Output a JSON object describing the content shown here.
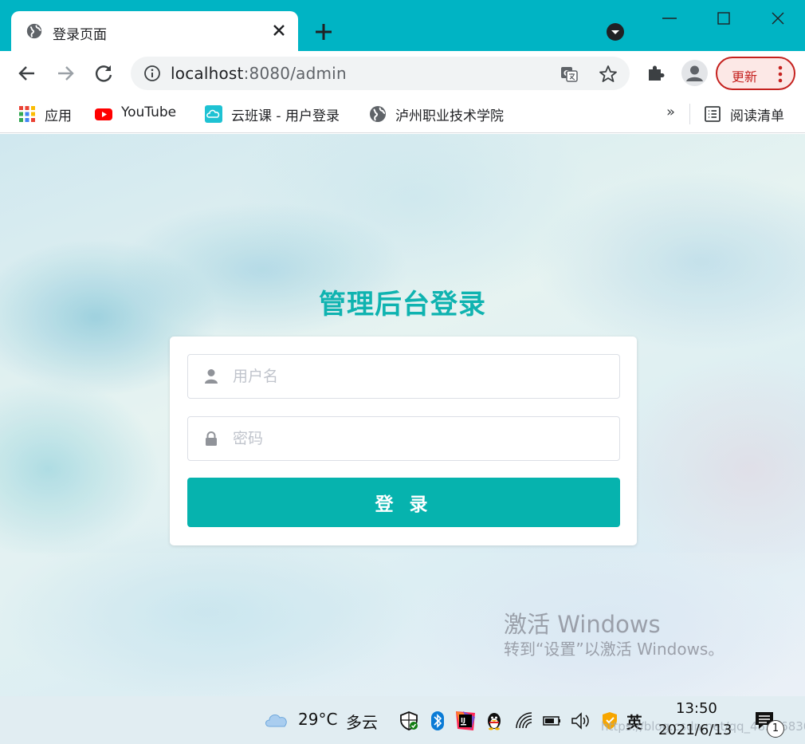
{
  "browser": {
    "tab": {
      "title": "登录页面"
    },
    "address": {
      "host": "localhost",
      "port_path": ":8080/admin"
    },
    "update_label": "更新",
    "bookmarks": [
      {
        "label": "应用",
        "icon": "apps-grid-icon"
      },
      {
        "label": "YouTube",
        "icon": "youtube-icon"
      },
      {
        "label": "云班课 - 用户登录",
        "icon": "cloud-class-icon"
      },
      {
        "label": "泸州职业技术学院",
        "icon": "globe-icon"
      }
    ],
    "more_bookmarks": "»",
    "reading_list": "阅读清单",
    "colors": {
      "tab_strip": "#00b4c4",
      "update_accent": "#c5221f"
    }
  },
  "login": {
    "title": "管理后台登录",
    "username_placeholder": "用户名",
    "password_placeholder": "密码",
    "submit_label": "登 录",
    "colors": {
      "accent": "#06b3ae",
      "title": "#0fb3b0"
    }
  },
  "activation": {
    "title": "激活 Windows",
    "subtitle": "转到“设置”以激活 Windows。"
  },
  "taskbar": {
    "temperature": "29°C",
    "weather": "多云",
    "ime": "英",
    "time": "13:50",
    "date": "2021/6/13",
    "watermark": "https://blog.csdn.net/qq_48516830",
    "notification_count": "1"
  }
}
